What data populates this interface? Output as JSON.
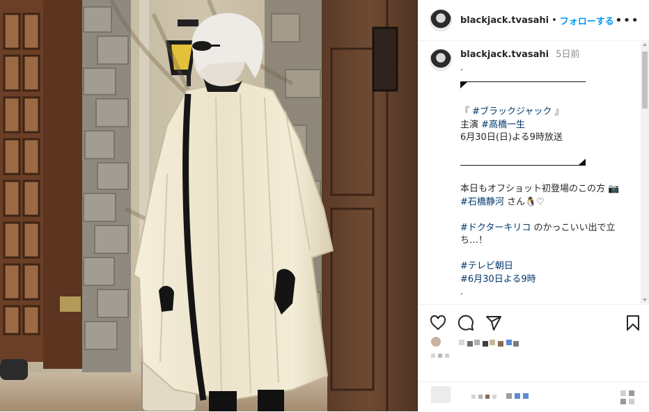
{
  "post": {
    "username": "blackjack.tvasahi",
    "dot": "•",
    "follow_label": "フォローする",
    "more_label": "•••"
  },
  "caption": {
    "username": "blackjack.tvasahi",
    "time": "5日前",
    "lines": {
      "l1": ".",
      "l2": "『 #ブラックジャック 』",
      "l3_pre": "主演 ",
      "l3_tag": "#高橋一生",
      "l4": "6月30日(日)よる9時放送",
      "l5": "本日もオフショット初登場のこの方 📷",
      "l6_tag": "#石橋静河",
      "l6_post": " さん🐧♡",
      "l7_tag": "#ドクターキリコ",
      "l7_post": " のかっこいい出で立",
      "l8": "ち…！",
      "l9_tag": "#テレビ朝日",
      "l10_tag": "#6月30日よる9時",
      "l11": "."
    }
  },
  "icons": {
    "like": "heart-icon",
    "comment": "comment-icon",
    "share": "send-icon",
    "save": "bookmark-icon"
  },
  "colors": {
    "link": "#0095f6",
    "hashtag": "#00376b",
    "text": "#262626",
    "muted": "#8e8e8e"
  }
}
